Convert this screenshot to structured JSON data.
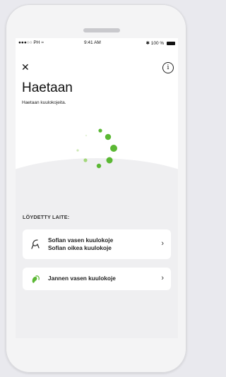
{
  "status_bar": {
    "carrier": "●●●○○ PH",
    "time": "9:41 AM",
    "battery": "100 %"
  },
  "header": {
    "close_icon": "close-icon",
    "info_icon": "info-icon",
    "title": "Haetaan",
    "subtitle": "Haetaan kuulokojeita."
  },
  "spinner": {
    "icon": "loading-spinner-icon",
    "color": "#5bb834"
  },
  "found_devices": {
    "section_label": "LÖYDETTY LAITE:",
    "devices": [
      {
        "icon": "hearing-aid-outline-icon",
        "lines": [
          "Sofian vasen kuulokoje",
          "Sofian oikea kuulokoje"
        ],
        "chevron": "›"
      },
      {
        "icon": "hearing-aid-green-icon",
        "lines": [
          "Jannen vasen kuulokoje"
        ],
        "chevron": "›"
      }
    ]
  },
  "colors": {
    "accent": "#5bb834",
    "background": "#efeff1",
    "card": "#ffffff"
  }
}
